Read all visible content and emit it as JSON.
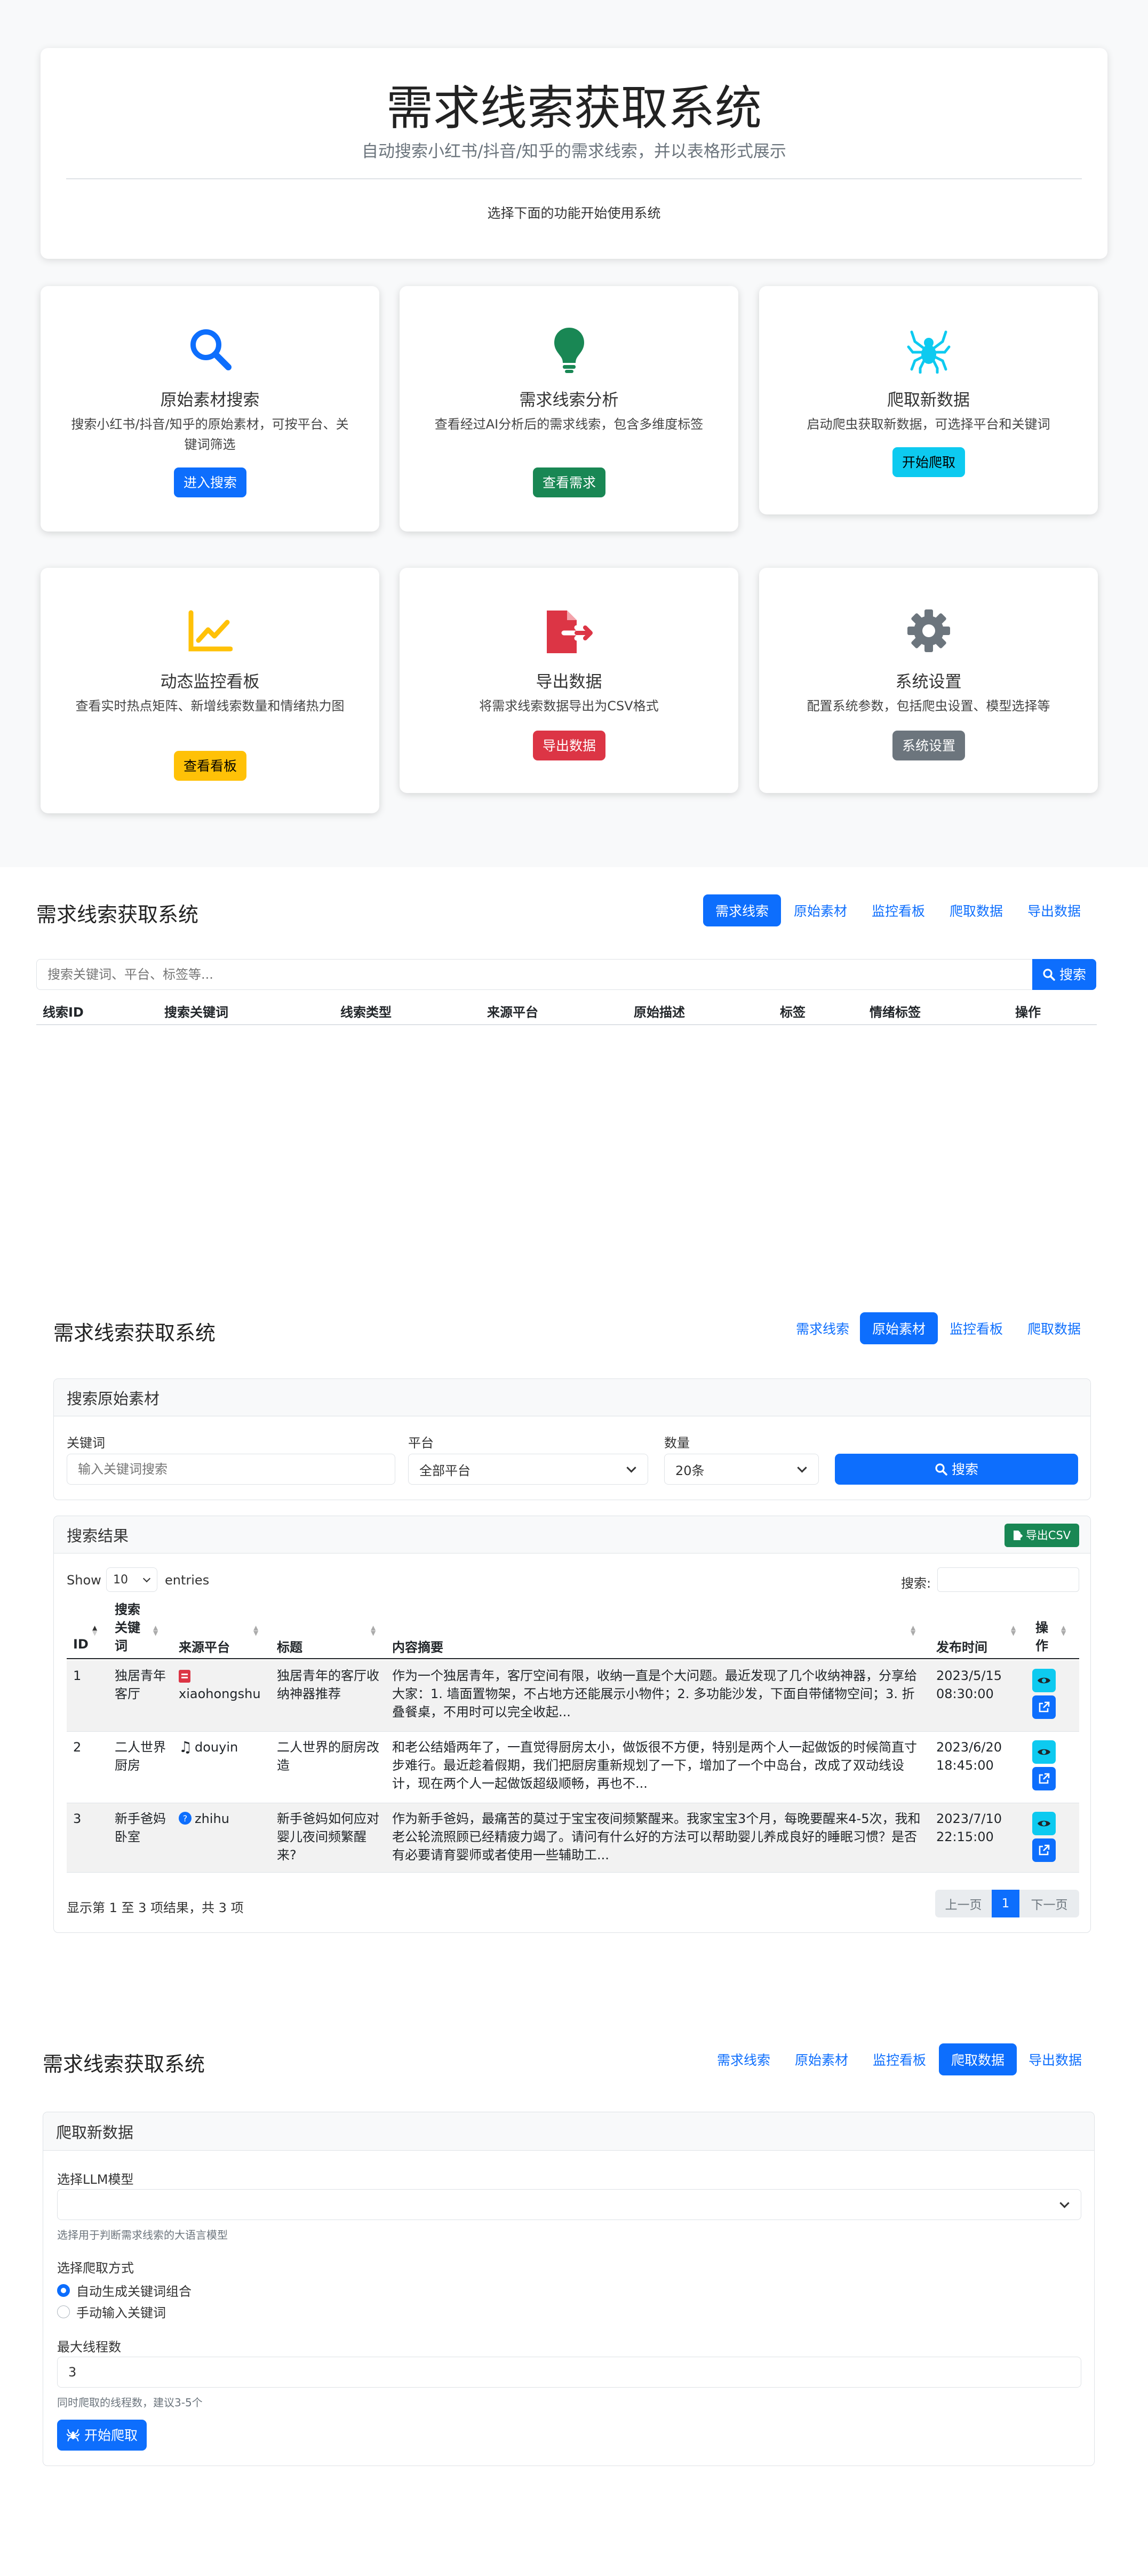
{
  "hero": {
    "title": "需求线索获取系统",
    "subtitle": "自动搜索小红书/抖音/知乎的需求线索，并以表格形式展示",
    "hint": "选择下面的功能开始使用系统"
  },
  "cards": [
    {
      "icon": "search-icon",
      "title": "原始素材搜索",
      "desc": "搜索小红书/抖音/知乎的原始素材，可按平台、关键词筛选",
      "button": "进入搜索",
      "color": "#0d6efd",
      "text_color": "#ffffff"
    },
    {
      "icon": "lightbulb-icon",
      "title": "需求线索分析",
      "desc": "查看经过AI分析后的需求线索，包含多维度标签",
      "button": "查看需求",
      "color": "#198754",
      "text_color": "#ffffff"
    },
    {
      "icon": "spider-icon",
      "title": "爬取新数据",
      "desc": "启动爬虫获取新数据，可选择平台和关键词",
      "button": "开始爬取",
      "color": "#0dcaf0",
      "text_color": "#000000"
    },
    {
      "icon": "chart-line-icon",
      "title": "动态监控看板",
      "desc": "查看实时热点矩阵、新增线索数量和情绪热力图",
      "button": "查看看板",
      "color": "#ffc107",
      "text_color": "#000000"
    },
    {
      "icon": "file-export-icon",
      "title": "导出数据",
      "desc": "将需求线索数据导出为CSV格式",
      "button": "导出数据",
      "color": "#dc3545",
      "text_color": "#ffffff"
    },
    {
      "icon": "gear-icon",
      "title": "系统设置",
      "desc": "配置系统参数，包括爬虫设置、模型选择等",
      "button": "系统设置",
      "color": "#6c757d",
      "text_color": "#ffffff"
    }
  ],
  "brand": "需求线索获取系统",
  "section2": {
    "nav": [
      "需求线索",
      "原始素材",
      "监控看板",
      "爬取数据",
      "导出数据"
    ],
    "search_placeholder": "搜索关键词、平台、标签等...",
    "search_button": "搜索",
    "columns": [
      "线索ID",
      "搜索关键词",
      "线索类型",
      "来源平台",
      "原始描述",
      "标签",
      "情绪标签",
      "操作"
    ]
  },
  "section3": {
    "nav": [
      "需求线索",
      "原始素材",
      "监控看板",
      "爬取数据"
    ],
    "panel_title": "搜索原始素材",
    "keyword_label": "关键词",
    "keyword_placeholder": "输入关键词搜索",
    "platform_label": "平台",
    "platform_value": "全部平台",
    "count_label": "数量",
    "count_value": "20条",
    "search_button": "搜索",
    "results_title": "搜索结果",
    "export_button": "导出CSV",
    "show_label": "Show",
    "show_value": "10",
    "entries_label": "entries",
    "search_label": "搜索:",
    "columns": [
      "ID",
      "搜索关键词",
      "来源平台",
      "标题",
      "内容摘要",
      "发布时间",
      "操作"
    ],
    "rows": [
      {
        "id": "1",
        "keyword": "独居青年 客厅",
        "platform": "xiaohongshu",
        "platform_icon": "xiaohongshu-icon",
        "title": "独居青年的客厅收纳神器推荐",
        "summary": "作为一个独居青年，客厅空间有限，收纳一直是个大问题。最近发现了几个收纳神器，分享给大家：1. 墙面置物架，不占地方还能展示小物件；2. 多功能沙发，下面自带储物空间；3. 折叠餐桌，不用时可以完全收起...",
        "time": "2023/5/15 08:30:00"
      },
      {
        "id": "2",
        "keyword": "二人世界 厨房",
        "platform": "douyin",
        "platform_icon": "music-note-icon",
        "title": "二人世界的厨房改造",
        "summary": "和老公结婚两年了，一直觉得厨房太小，做饭很不方便，特别是两个人一起做饭的时候简直寸步难行。最近趁着假期，我们把厨房重新规划了一下，增加了一个中岛台，改成了双动线设计，现在两个人一起做饭超级顺畅，再也不...",
        "time": "2023/6/20 18:45:00"
      },
      {
        "id": "3",
        "keyword": "新手爸妈 卧室",
        "platform": "zhihu",
        "platform_icon": "zhihu-icon",
        "title": "新手爸妈如何应对婴儿夜间频繁醒来?",
        "summary": "作为新手爸妈，最痛苦的莫过于宝宝夜间频繁醒来。我家宝宝3个月，每晚要醒来4-5次，我和老公轮流照顾已经精疲力竭了。请问有什么好的方法可以帮助婴儿养成良好的睡眠习惯？是否有必要请育婴师或者使用一些辅助工...",
        "time": "2023/7/10 22:15:00"
      }
    ],
    "info": "显示第 1 至 3 项结果，共 3 项",
    "prev": "上一页",
    "page": "1",
    "next": "下一页"
  },
  "section4": {
    "nav": [
      "需求线索",
      "原始素材",
      "监控看板",
      "爬取数据",
      "导出数据"
    ],
    "panel_title": "爬取新数据",
    "llm_label": "选择LLM模型",
    "llm_value": "",
    "llm_help": "选择用于判断需求线索的大语言模型",
    "mode_label": "选择爬取方式",
    "mode_options": [
      "自动生成关键词组合",
      "手动输入关键词"
    ],
    "mode_selected": 0,
    "threads_label": "最大线程数",
    "threads_value": "3",
    "threads_help": "同时爬取的线程数，建议3-5个",
    "start_button": "开始爬取"
  },
  "colors": {
    "primary": "#0d6efd",
    "success": "#198754",
    "info": "#0dcaf0",
    "warning": "#ffc107",
    "danger": "#dc3545",
    "secondary": "#6c757d",
    "bg": "#f8f9fa"
  }
}
